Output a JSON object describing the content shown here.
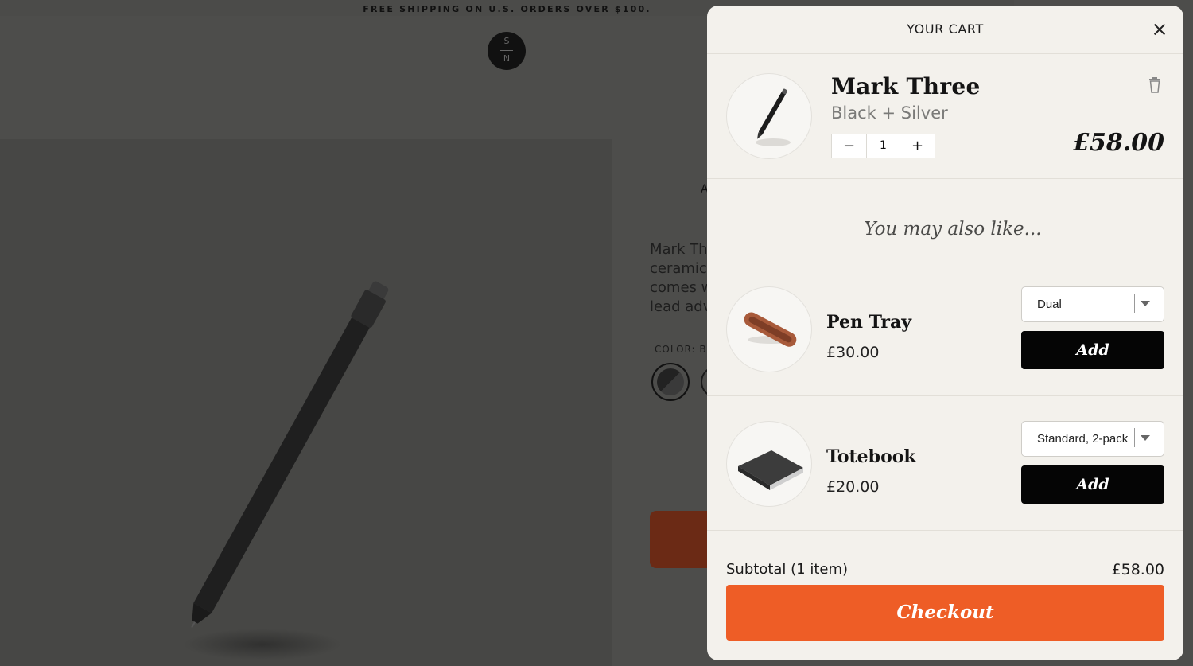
{
  "background_page": {
    "promo_text": "FREE SHIPPING ON U.S. ORDERS OVER $100.",
    "logo": {
      "top_letter": "S",
      "bottom_letter": "N"
    },
    "partial_heading_letter": "A",
    "description_fragment": [
      "Mark Thr",
      "ceramic b",
      "comes wi",
      "lead adva"
    ],
    "color_label": "COLOR: B"
  },
  "cart": {
    "title": "YOUR CART",
    "item": {
      "name": "Mark Three",
      "variant": "Black + Silver",
      "quantity": "1",
      "minus_label": "−",
      "plus_label": "+",
      "price": "£58.00"
    },
    "upsell_heading": "You may also like...",
    "upsells": [
      {
        "name": "Pen Tray",
        "price": "£30.00",
        "option": "Dual",
        "add_label": "Add"
      },
      {
        "name": "Totebook",
        "price": "£20.00",
        "option": "Standard, 2-pack",
        "add_label": "Add"
      }
    ],
    "subtotal_label": "Subtotal (1 item)",
    "subtotal_value": "£58.00",
    "checkout_label": "Checkout"
  },
  "colors": {
    "checkout_orange": "#ee5d26",
    "drawer_background": "#f3f1ec",
    "overlay_dim": "#4d4d4b",
    "add_button": "#050505"
  },
  "icons": [
    "close-icon",
    "trash-icon",
    "chevron-down-icon"
  ]
}
